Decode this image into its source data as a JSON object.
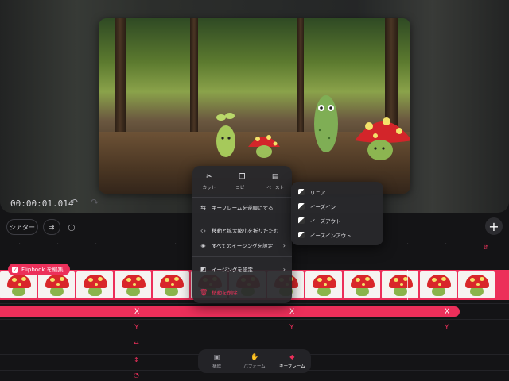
{
  "player": {
    "timecode": "00:00:01.014",
    "undo_icon": "undo-icon",
    "redo_icon": "redo-icon"
  },
  "toolbar": {
    "theater_label": "シアター",
    "split_icon": "split-icon",
    "comment_icon": "comment-bubble-icon",
    "add_icon": "plus-icon"
  },
  "timeline": {
    "flipbook_badge": "Flipbook を編集",
    "keyframe_x_label": "X",
    "keyframe_y_label": "Y",
    "frame_count": 13
  },
  "context_menu": {
    "cut": "カット",
    "copy": "コピー",
    "paste": "ペースト",
    "reverse": "キーフレームを逆順にする",
    "collapse": "移動と拡大縮小を折りたたむ",
    "set_all_easing": "すべてのイージングを設定",
    "set_easing": "イージングを設定",
    "delete": "移動を削除"
  },
  "easing_submenu": {
    "items": [
      "リニア",
      "イーズイン",
      "イーズアウト",
      "イーズインアウト"
    ]
  },
  "bottom_nav": {
    "tabs": [
      "構成",
      "パフォーム",
      "キーフレーム"
    ],
    "active": "キーフレーム"
  },
  "colors": {
    "accent": "#ec2f5a",
    "background": "#141416",
    "menu": "#28282c"
  }
}
